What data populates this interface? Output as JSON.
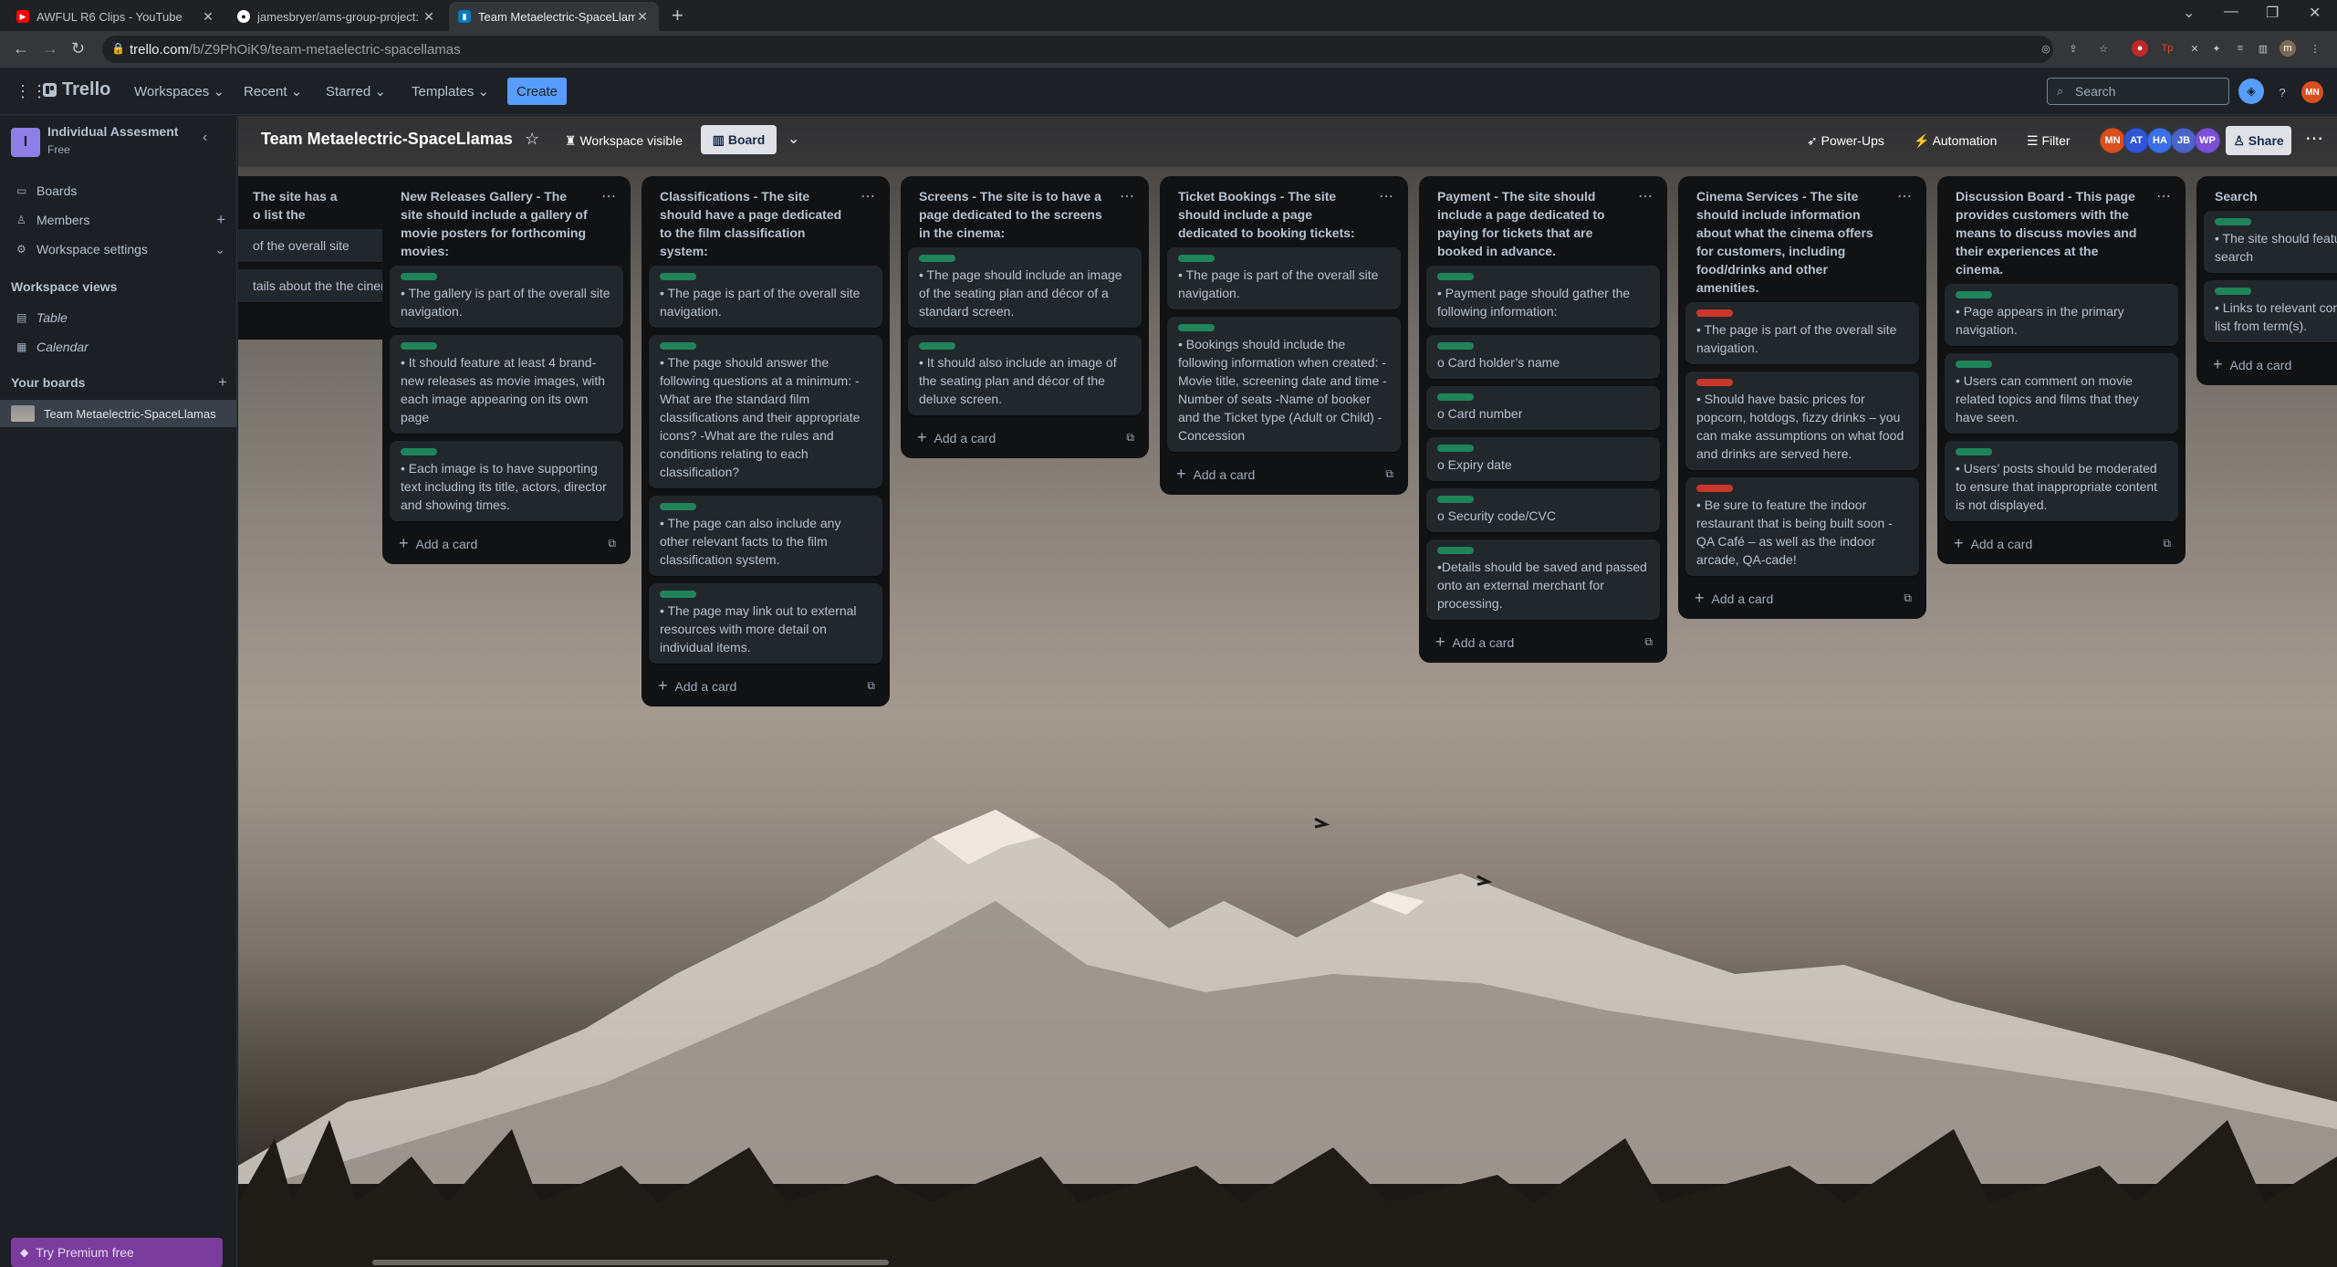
{
  "browser": {
    "tabs": [
      {
        "title": "AWFUL R6 Clips - YouTube",
        "favicon": "youtube-icon",
        "color": "#ff0000"
      },
      {
        "title": "jamesbryer/ams-group-project: A",
        "favicon": "github-icon",
        "color": "#ffffff"
      },
      {
        "title": "Team Metaelectric-SpaceLlamas",
        "favicon": "trello-icon",
        "color": "#0079bf"
      }
    ],
    "url_host": "trello.com",
    "url_path": "/b/Z9PhOiK9/team-metaelectric-spacellamas"
  },
  "header": {
    "logo": "Trello",
    "menus": [
      "Workspaces",
      "Recent",
      "Starred",
      "Templates"
    ],
    "create_label": "Create",
    "search_placeholder": "Search",
    "user_initials": "MN"
  },
  "sidebar": {
    "workspace_initial": "I",
    "workspace_name": "Individual Assesment",
    "workspace_plan": "Free",
    "items": [
      {
        "label": "Boards",
        "icon": "boards-icon"
      },
      {
        "label": "Members",
        "icon": "members-icon"
      },
      {
        "label": "Workspace settings",
        "icon": "gear-icon"
      }
    ],
    "views_title": "Workspace views",
    "views": [
      {
        "label": "Table",
        "icon": "table-icon"
      },
      {
        "label": "Calendar",
        "icon": "calendar-icon"
      }
    ],
    "your_boards_title": "Your boards",
    "boards": [
      "Team Metaelectric-SpaceLlamas"
    ],
    "premium_label": "Try Premium free"
  },
  "board": {
    "title": "Team Metaelectric-SpaceLlamas",
    "visibility": "Workspace visible",
    "view": "Board",
    "power_ups": "Power-Ups",
    "automation": "Automation",
    "filter": "Filter",
    "share": "Share",
    "members": [
      {
        "initials": "MN",
        "color": "#d94f1e"
      },
      {
        "initials": "AT",
        "color": "#2f55d4"
      },
      {
        "initials": "HA",
        "color": "#3b6ee8"
      },
      {
        "initials": "JB",
        "color": "#4a64c8"
      },
      {
        "initials": "WP",
        "color": "#7b4fd6"
      }
    ],
    "add_card": "Add a card"
  },
  "lists": [
    {
      "title": "The site has a o list the",
      "title_lines": [
        "The site has a",
        "o list the"
      ],
      "cards": [
        {
          "labels": [],
          "text": "of the overall site"
        },
        {
          "labels": [],
          "text": "tails about the the cinema."
        }
      ]
    },
    {
      "title": "New Releases Gallery -  The site should include a gallery of movie posters for forthcoming movies:",
      "cards": [
        {
          "labels": [
            "green"
          ],
          "text": "• The gallery is part of the overall site navigation."
        },
        {
          "labels": [
            "green"
          ],
          "text": "• It should feature at least 4 brand-new releases as movie images, with each image appearing on its own page"
        },
        {
          "labels": [
            "green"
          ],
          "text": "• Each image is to have supporting text including its title, actors, director and showing times."
        }
      ]
    },
    {
      "title": "Classifications - The site should have a page dedicated to the film classification system:",
      "cards": [
        {
          "labels": [
            "green"
          ],
          "text": "• The page is part of the overall site navigation."
        },
        {
          "labels": [
            "green"
          ],
          "text": "• The page should answer the following questions at a minimum: -What are the standard film classifications and their appropriate icons? -What are the rules and conditions relating to each classification?"
        },
        {
          "labels": [
            "green"
          ],
          "text": "• The page can also include any other relevant facts to the film classification system."
        },
        {
          "labels": [
            "green"
          ],
          "text": "• The page may link out to external resources with more detail on individual items."
        }
      ]
    },
    {
      "title": "Screens - The site is to have a page dedicated to the screens in the cinema:",
      "cards": [
        {
          "labels": [
            "green"
          ],
          "text": "• The page should include an image of the seating plan and décor of a standard screen."
        },
        {
          "labels": [
            "green"
          ],
          "text": "• It should also include an image of the seating plan and décor of the deluxe screen."
        }
      ]
    },
    {
      "title": "Ticket Bookings - The site should include a page dedicated to booking tickets:",
      "cards": [
        {
          "labels": [
            "green"
          ],
          "text": "• The page is part of the overall site navigation."
        },
        {
          "labels": [
            "green"
          ],
          "text": "• Bookings should include the following information when created: -Movie title, screening date and time -Number of seats -Name of booker and the Ticket type (Adult or Child) -Concession"
        }
      ]
    },
    {
      "title": "Payment - The site should include a page dedicated to paying for tickets that are booked in advance.",
      "cards": [
        {
          "labels": [
            "green"
          ],
          "text": "• Payment page should gather the following information:"
        },
        {
          "labels": [
            "green"
          ],
          "text": "o Card holder’s name"
        },
        {
          "labels": [
            "green"
          ],
          "text": "o Card number"
        },
        {
          "labels": [
            "green"
          ],
          "text": "o Expiry date"
        },
        {
          "labels": [
            "green"
          ],
          "text": "o Security code/CVC"
        },
        {
          "labels": [
            "green"
          ],
          "text": "•Details should be saved and passed onto an external merchant for processing."
        }
      ]
    },
    {
      "title": "Cinema Services - The site should include information about what the cinema offers for customers, including food/drinks and other amenities.",
      "cards": [
        {
          "labels": [
            "red"
          ],
          "text": "• The page is part of the overall site navigation."
        },
        {
          "labels": [
            "red"
          ],
          "text": "• Should have basic prices for popcorn, hotdogs, fizzy drinks – you can make assumptions on what food and drinks are served here."
        },
        {
          "labels": [
            "red"
          ],
          "text": "• Be sure to feature the indoor restaurant that is being built soon - QA Café – as well as the indoor arcade, QA-cade!"
        }
      ]
    },
    {
      "title": "Discussion Board - This page provides customers with the means to discuss movies and their experiences at the cinema.",
      "cards": [
        {
          "labels": [
            "green"
          ],
          "text": "• Page appears in the primary navigation."
        },
        {
          "labels": [
            "green"
          ],
          "text": "• Users can comment on movie related topics and films that they have seen."
        },
        {
          "labels": [
            "green"
          ],
          "text": "• Users’ posts should be moderated to ensure that inappropriate content is not displayed."
        }
      ]
    },
    {
      "title": "Search",
      "cards": [
        {
          "labels": [
            "green"
          ],
          "text": "• The site should featu that lets users search"
        },
        {
          "labels": [
            "green"
          ],
          "text": "• Links to relevant con returned in a list from term(s)."
        }
      ]
    }
  ]
}
